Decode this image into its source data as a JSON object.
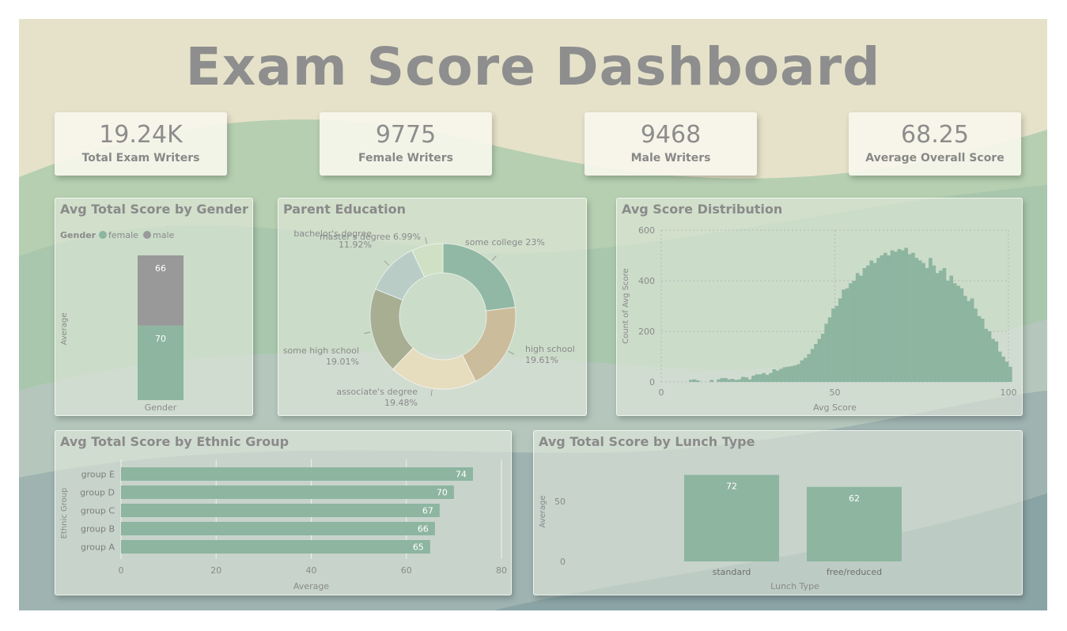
{
  "header": {
    "title": "Exam Score Dashboard"
  },
  "kpis": [
    {
      "value": "19.24K",
      "label": "Total Exam Writers"
    },
    {
      "value": "9775",
      "label": "Female Writers"
    },
    {
      "value": "9468",
      "label": "Male Writers"
    },
    {
      "value": "68.25",
      "label": "Average Overall Score"
    }
  ],
  "colors": {
    "female": "#8db5a0",
    "male": "#999999",
    "background": "#e6e2c9",
    "accent": "#8db5a0"
  },
  "panels": {
    "gender": {
      "title": "Avg Total Score by Gender",
      "legend_title": "Gender",
      "legend_female": "female",
      "legend_male": "male"
    },
    "parent": {
      "title": "Parent Education"
    },
    "dist": {
      "title": "Avg Score Distribution"
    },
    "ethnic": {
      "title": "Avg Total Score by Ethnic Group"
    },
    "lunch": {
      "title": "Avg Total Score by Lunch Type"
    }
  },
  "chart_data": [
    {
      "id": "gender",
      "type": "bar",
      "stacked": true,
      "categories": [
        "Gender"
      ],
      "series": [
        {
          "name": "female",
          "values": [
            70
          ],
          "color": "#8db5a0"
        },
        {
          "name": "male",
          "values": [
            66
          ],
          "color": "#999999"
        }
      ],
      "xlabel": "Gender",
      "ylabel": "Average"
    },
    {
      "id": "parent",
      "type": "pie",
      "donut": true,
      "slices": [
        {
          "label": "some college",
          "percent": 23,
          "display": "some college 23%",
          "color": "#91b8a4"
        },
        {
          "label": "high school",
          "percent": 19.61,
          "display": "high school|19.61%",
          "color": "#cbbd9c"
        },
        {
          "label": "associate's degree",
          "percent": 19.48,
          "display": "associate's degree|19.48%",
          "color": "#e6dcbe"
        },
        {
          "label": "some high school",
          "percent": 19.01,
          "display": "some high school|19.01%",
          "color": "#a7ae92"
        },
        {
          "label": "bachelor's degree",
          "percent": 11.92,
          "display": "bachelor's degree|11.92%",
          "color": "#b9cdc6"
        },
        {
          "label": "master's degree",
          "percent": 6.99,
          "display": "master's degree 6.99%",
          "color": "#cfe0c4"
        }
      ]
    },
    {
      "id": "dist",
      "type": "bar",
      "subtype": "histogram",
      "xlabel": "Avg Score",
      "ylabel": "Count of Avg Score",
      "xlim": [
        0,
        100
      ],
      "ylim": [
        0,
        600
      ],
      "xticks": [
        0,
        50,
        100
      ],
      "yticks": [
        0,
        200,
        400,
        600
      ],
      "grid": true,
      "bin_start": 0,
      "bin_width": 1,
      "counts": [
        0,
        0,
        0,
        0,
        0,
        0,
        0,
        0,
        8,
        10,
        6,
        0,
        0,
        0,
        8,
        0,
        10,
        15,
        15,
        10,
        12,
        8,
        10,
        20,
        18,
        10,
        25,
        30,
        30,
        35,
        28,
        35,
        50,
        45,
        52,
        58,
        60,
        62,
        65,
        70,
        85,
        95,
        110,
        130,
        150,
        170,
        190,
        230,
        255,
        290,
        300,
        330,
        365,
        370,
        390,
        400,
        430,
        420,
        450,
        460,
        480,
        470,
        490,
        500,
        510,
        500,
        520,
        515,
        525,
        520,
        530,
        505,
        510,
        490,
        480,
        470,
        450,
        490,
        460,
        430,
        440,
        450,
        400,
        420,
        390,
        380,
        370,
        340,
        320,
        330,
        290,
        260,
        250,
        210,
        200,
        170,
        160,
        120,
        100,
        80,
        60
      ]
    },
    {
      "id": "ethnic",
      "type": "bar",
      "orientation": "horizontal",
      "categories": [
        "group E",
        "group D",
        "group C",
        "group B",
        "group A"
      ],
      "values": [
        74,
        70,
        67,
        66,
        65
      ],
      "xlabel": "Average",
      "ylabel": "Ethnic Group",
      "xlim": [
        0,
        80
      ],
      "xticks": [
        0,
        20,
        40,
        60,
        80
      ]
    },
    {
      "id": "lunch",
      "type": "bar",
      "categories": [
        "standard",
        "free/reduced"
      ],
      "values": [
        72,
        62
      ],
      "xlabel": "Lunch Type",
      "ylabel": "Average",
      "yticks": [
        0,
        50
      ]
    }
  ]
}
